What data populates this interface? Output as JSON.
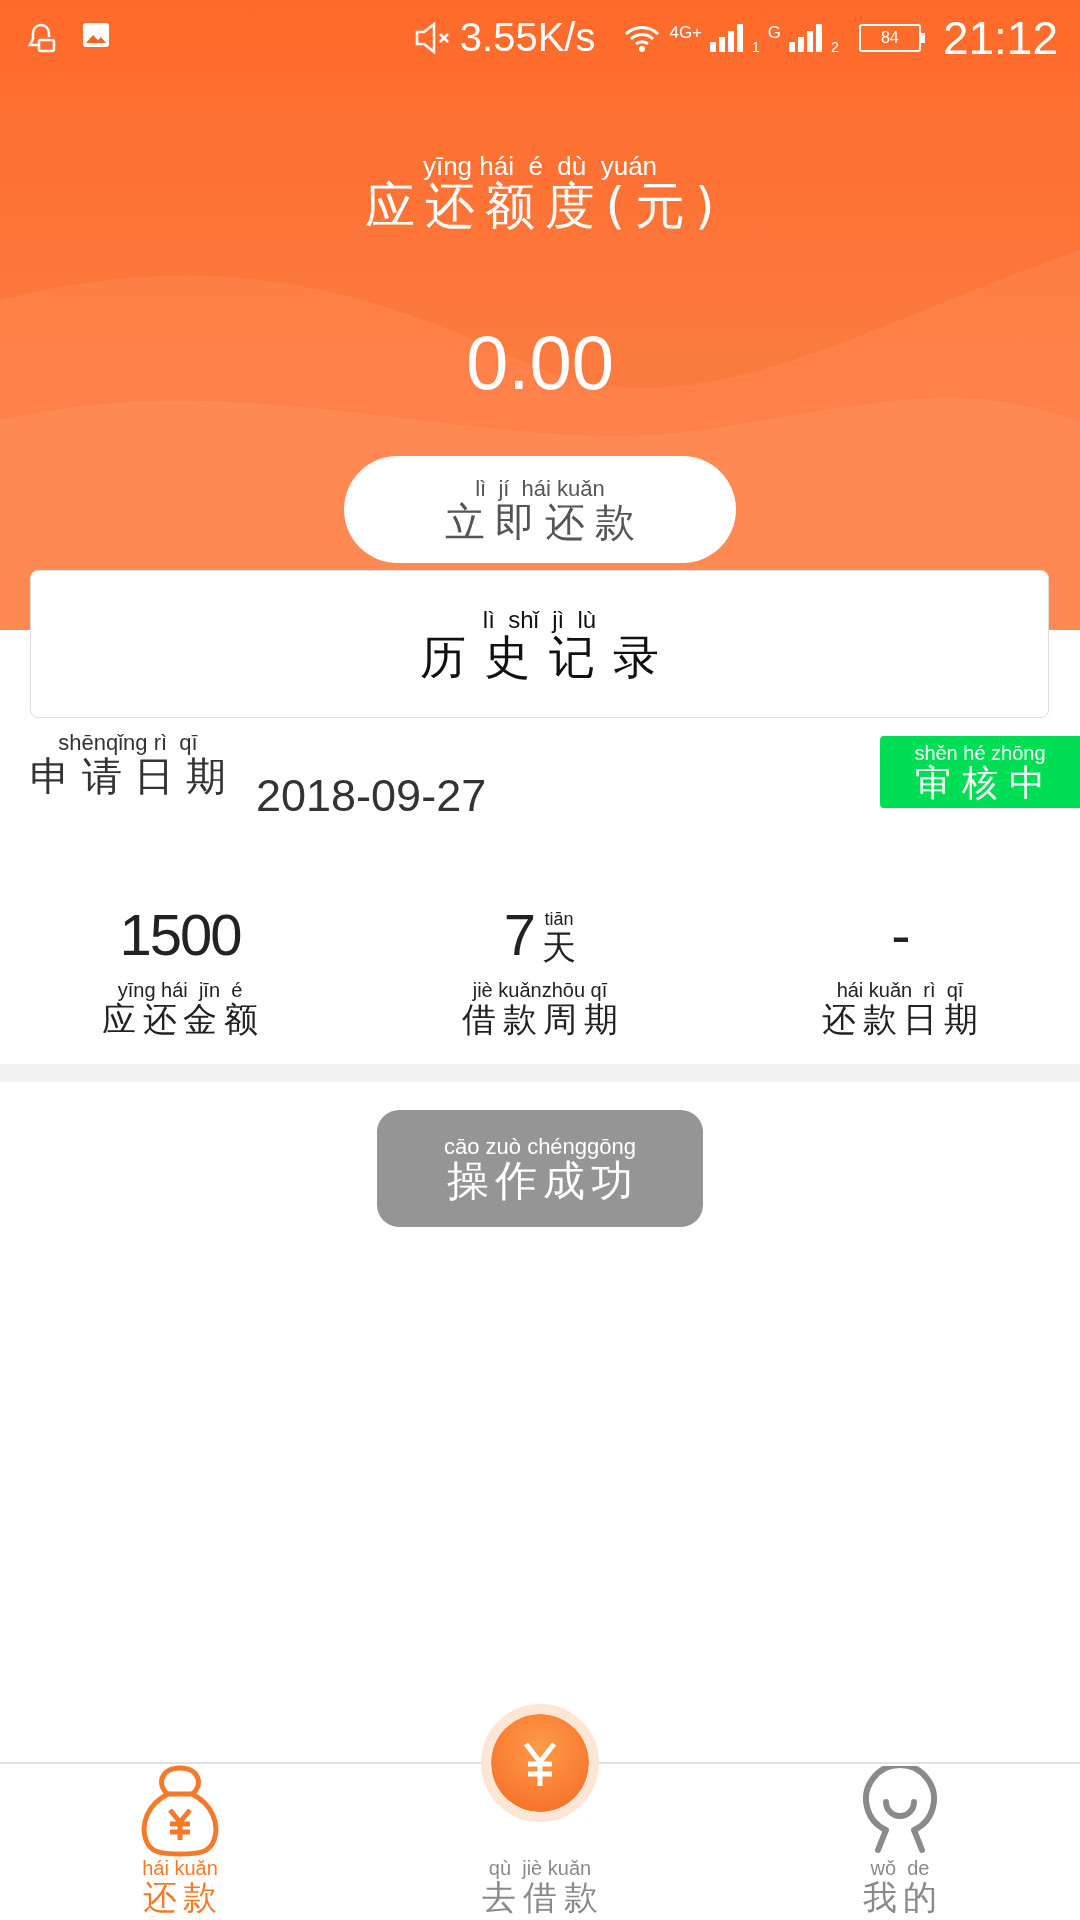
{
  "status_bar": {
    "speed": "3.55K/s",
    "network_1": "4G+",
    "sim_1": "1",
    "network_2": "G",
    "sim_2": "2",
    "battery": "84",
    "time": "21:12"
  },
  "header": {
    "title": {
      "pinyin": "yīng hái  é  dù  yuán",
      "text": "应还额度(元)"
    },
    "amount": "0.00",
    "repay_button": {
      "pinyin": "lì  jí  hái kuǎn",
      "text": "立即还款"
    }
  },
  "history_button": {
    "pinyin": "lì  shǐ  jì  lù",
    "text": "历史记录"
  },
  "application": {
    "date_label": {
      "pinyin": "shēnqǐng rì  qī",
      "text": "申请日期"
    },
    "date": "2018-09-27",
    "status": {
      "pinyin": "shěn hé zhōng",
      "text": "审核中"
    },
    "stats": [
      {
        "value": "1500",
        "label": {
          "pinyin": "yīng hái  jīn  é",
          "text": "应还金额"
        }
      },
      {
        "value": "7",
        "unit": {
          "pinyin": "tiān",
          "text": "天"
        },
        "label": {
          "pinyin": "jiè kuǎnzhōu qī",
          "text": "借款周期"
        }
      },
      {
        "value": "-",
        "label": {
          "pinyin": "hái kuǎn  rì  qī",
          "text": "还款日期"
        }
      }
    ]
  },
  "toast": {
    "pinyin": "cāo zuò chénggōng",
    "text": "操作成功"
  },
  "nav": [
    {
      "kind": "repay",
      "pinyin": "hái kuǎn",
      "text": "还款",
      "selected": true
    },
    {
      "kind": "borrow",
      "pinyin": "qù  jiè kuǎn",
      "text": "去借款",
      "selected": false
    },
    {
      "kind": "mine",
      "pinyin": "wǒ  de",
      "text": "我的",
      "selected": false
    }
  ]
}
